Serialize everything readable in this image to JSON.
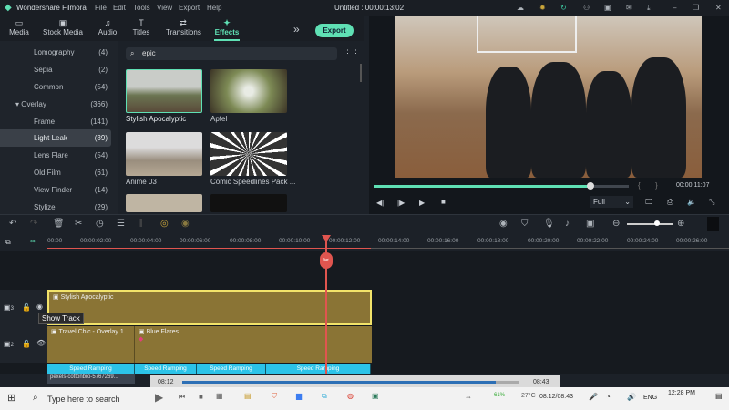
{
  "title_bar": {
    "app_name": "Wondershare Filmora",
    "menus": [
      "File",
      "Edit",
      "Tools",
      "View",
      "Export",
      "Help"
    ],
    "project_title": "Untitled : 00:00:13:02"
  },
  "toolbar": {
    "tabs": [
      {
        "label": "Media",
        "icon": "folder-icon"
      },
      {
        "label": "Stock Media",
        "icon": "stock-media-icon"
      },
      {
        "label": "Audio",
        "icon": "music-icon"
      },
      {
        "label": "Titles",
        "icon": "text-icon"
      },
      {
        "label": "Transitions",
        "icon": "transition-icon"
      },
      {
        "label": "Effects",
        "icon": "effects-icon"
      }
    ],
    "active": "Effects",
    "more": "»",
    "export_label": "Export"
  },
  "sidebar": {
    "items": [
      {
        "label": "Lomography",
        "count": "(4)"
      },
      {
        "label": "Sepia",
        "count": "(2)"
      },
      {
        "label": "Common",
        "count": "(54)"
      },
      {
        "label": "Overlay",
        "count": "(366)",
        "expanded": true
      },
      {
        "label": "Frame",
        "count": "(141)"
      },
      {
        "label": "Light Leak",
        "count": "(39)",
        "selected": true
      },
      {
        "label": "Lens Flare",
        "count": "(54)"
      },
      {
        "label": "Old Film",
        "count": "(61)"
      },
      {
        "label": "View Finder",
        "count": "(14)"
      },
      {
        "label": "Stylize",
        "count": "(29)"
      }
    ]
  },
  "effects": {
    "search_value": "epic",
    "items": [
      {
        "label": "Stylish Apocalyptic"
      },
      {
        "label": "Apfel"
      },
      {
        "label": "Anime 03"
      },
      {
        "label": "Comic Speedlines Pack ..."
      }
    ]
  },
  "preview": {
    "timecode": "00:00:11:07",
    "progress": 0.85,
    "quality": "Full",
    "mark_in": "{",
    "mark_out": "}"
  },
  "timeline": {
    "ruler": [
      "00:00",
      "00:00:02:00",
      "00:00:04:00",
      "00:00:06:00",
      "00:00:08:00",
      "00:00:10:00",
      "00:00:12:00",
      "00:00:14:00",
      "00:00:16:00",
      "00:00:18:00",
      "00:00:20:00",
      "00:00:22:00",
      "00:00:24:00",
      "00:00:26:00"
    ],
    "track3": {
      "clip": "Stylish Apocalyptic",
      "num": "3"
    },
    "track2": {
      "clips": [
        "Travel Chic - Overlay 1",
        "Blue Flares"
      ],
      "num": "2"
    },
    "speed_ramping": [
      "Speed Ramping",
      "Speed Ramping",
      "Speed Ramping",
      "Speed Ramping"
    ],
    "video_clips": [
      "pexels-cottonbro-5767269..."
    ],
    "tooltip": "Show Track"
  },
  "media_player": {
    "current": "08:12",
    "total": "08:43",
    "progress": 0.93
  },
  "taskbar": {
    "search_placeholder": "Type here to search",
    "battery": "61%",
    "temp": "27°C",
    "media_time": "08:12/08:43",
    "lang": "ENG",
    "time": "12:28 PM"
  }
}
